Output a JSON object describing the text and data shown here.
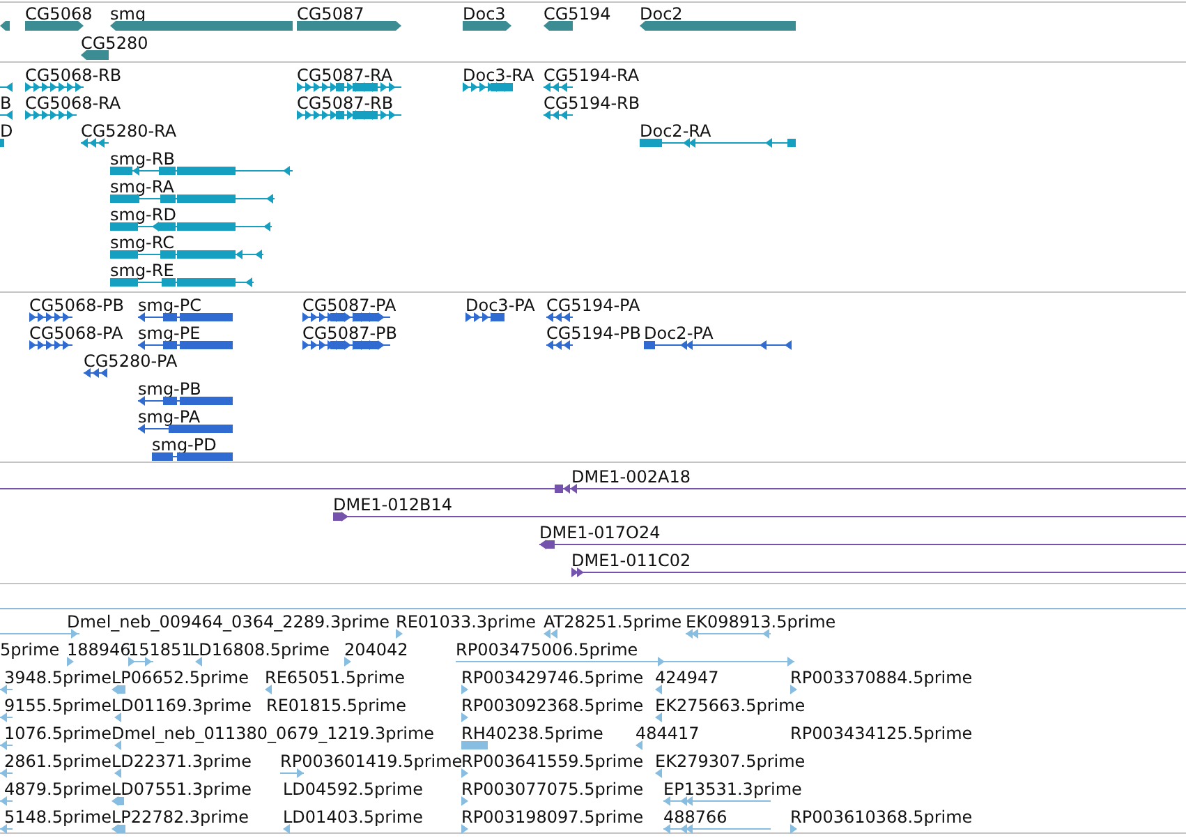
{
  "tracks": [
    {
      "kind": "gene",
      "color": "#3b8c93",
      "features": [
        {
          "reverse": true
        },
        {
          "label": "CG5068",
          "reverse": false
        },
        {
          "label": "smg",
          "reverse": true
        },
        {
          "label": "CG5087",
          "reverse": false
        },
        {
          "label": "Doc3",
          "reverse": false
        },
        {
          "label": "CG5194",
          "reverse": true
        },
        {
          "label": "Doc2",
          "reverse": true
        },
        {
          "label": "CG5280",
          "reverse": true
        }
      ]
    },
    {
      "kind": "transcript",
      "color": "#15a0c2",
      "features": [
        {
          "reverse": true
        },
        {
          "label": "CG5068-RB",
          "reverse": false
        },
        {
          "label": "CG5087-RA",
          "reverse": false
        },
        {
          "label": "Doc3-RA",
          "reverse": false
        },
        {
          "label": "CG5194-RA",
          "reverse": true
        },
        {
          "label": "B",
          "reverse": true
        },
        {
          "label": "CG5068-RA",
          "reverse": false
        },
        {
          "label": "CG5087-RB",
          "reverse": false
        },
        {
          "label": "CG5194-RB",
          "reverse": true
        },
        {
          "label": "D"
        },
        {
          "label": "CG5280-RA",
          "reverse": true
        },
        {
          "label": "Doc2-RA",
          "reverse": true
        },
        {
          "label": "smg-RB",
          "reverse": true
        },
        {
          "label": "smg-RA",
          "reverse": true
        },
        {
          "label": "smg-RD",
          "reverse": true
        },
        {
          "label": "smg-RC",
          "reverse": true
        },
        {
          "label": "smg-RE",
          "reverse": true
        }
      ]
    },
    {
      "kind": "protein",
      "color": "#2f6bd0",
      "features": [
        {
          "label": "CG5068-PB",
          "reverse": false
        },
        {
          "label": "smg-PC",
          "reverse": true
        },
        {
          "label": "CG5087-PA",
          "reverse": false
        },
        {
          "label": "Doc3-PA",
          "reverse": false
        },
        {
          "label": "CG5194-PA",
          "reverse": true
        },
        {
          "label": "CG5068-PA",
          "reverse": false
        },
        {
          "label": "smg-PE",
          "reverse": true
        },
        {
          "label": "CG5087-PB",
          "reverse": false
        },
        {
          "label": "CG5194-PB",
          "reverse": true
        },
        {
          "label": "Doc2-PA",
          "reverse": true
        },
        {
          "label": "CG5280-PA",
          "reverse": true
        },
        {
          "label": "smg-PB",
          "reverse": true
        },
        {
          "label": "smg-PA",
          "reverse": true
        },
        {
          "label": "smg-PD"
        }
      ]
    },
    {
      "kind": "clone",
      "color": "#7553ad",
      "features": [
        {
          "label": "DME1-002A18",
          "reverse": true
        },
        {
          "label": "DME1-012B14",
          "reverse": false
        },
        {
          "label": "DME1-017O24",
          "reverse": true
        },
        {
          "label": "DME1-011C02",
          "reverse": false
        }
      ]
    },
    {
      "kind": "est",
      "color": "#86bde0",
      "features": [
        {
          "reverse": false
        },
        {
          "label": "Dmel_neb_009464_0364_2289.3prime"
        },
        {
          "label": "RE01033.3prime",
          "reverse": false
        },
        {
          "label": "AT28251.5prime",
          "reverse": true
        },
        {
          "label": "EK098913.5prime",
          "reverse": true
        },
        {
          "label": "5prime"
        },
        {
          "label": "188946",
          "reverse": false
        },
        {
          "label": "151851",
          "reverse": false
        },
        {
          "label": "LD16808.5prime",
          "reverse": true
        },
        {
          "label": "204042",
          "reverse": false
        },
        {
          "label": "RP003475006.5prime",
          "reverse": false
        },
        {
          "label": "3948.5prime",
          "reverse": true
        },
        {
          "label": "LP06652.5prime",
          "reverse": true
        },
        {
          "label": "RE65051.5prime",
          "reverse": true
        },
        {
          "label": "RP003429746.5prime",
          "reverse": false
        },
        {
          "label": "424947",
          "reverse": true
        },
        {
          "label": "RP003370884.5prime",
          "reverse": false
        },
        {
          "label": "9155.5prime",
          "reverse": true
        },
        {
          "label": "LD01169.3prime",
          "reverse": true
        },
        {
          "label": "RE01815.5prime"
        },
        {
          "label": "RP003092368.5prime",
          "reverse": false
        },
        {
          "label": "EK275663.5prime",
          "reverse": true
        },
        {
          "label": "1076.5prime",
          "reverse": true
        },
        {
          "label": "Dmel_neb_011380_0679_1219.3prime",
          "reverse": true
        },
        {
          "label": "RH40238.5prime"
        },
        {
          "label": "484417",
          "reverse": true
        },
        {
          "label": "RP003434125.5prime"
        },
        {
          "label": "2861.5prime",
          "reverse": true
        },
        {
          "label": "LD22371.3prime",
          "reverse": true
        },
        {
          "label": "RP003601419.5prime",
          "reverse": false
        },
        {
          "label": "RP003641559.5prime",
          "reverse": false
        },
        {
          "label": "EK279307.5prime",
          "reverse": true
        },
        {
          "label": "4879.5prime",
          "reverse": true
        },
        {
          "label": "LD07551.3prime",
          "reverse": true
        },
        {
          "label": "LD04592.5prime"
        },
        {
          "label": "RP003077075.5prime",
          "reverse": false
        },
        {
          "label": "EP13531.3prime",
          "reverse": true
        },
        {
          "label": "5148.5prime",
          "reverse": true
        },
        {
          "label": "LP22782.3prime",
          "reverse": true
        },
        {
          "label": "LD01403.5prime",
          "reverse": true
        },
        {
          "label": "RP003198097.5prime",
          "reverse": false
        },
        {
          "label": "488766",
          "reverse": true
        },
        {
          "label": "RP003610368.5prime",
          "reverse": false
        }
      ]
    }
  ]
}
